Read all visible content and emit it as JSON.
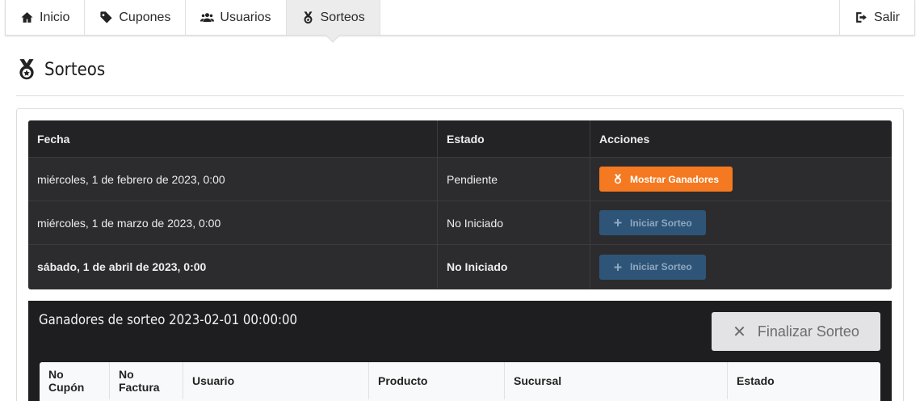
{
  "nav": {
    "items": [
      {
        "label": "Inicio",
        "icon": "home-icon"
      },
      {
        "label": "Cupones",
        "icon": "tag-icon"
      },
      {
        "label": "Usuarios",
        "icon": "users-icon"
      },
      {
        "label": "Sorteos",
        "icon": "medal-icon",
        "active": true
      }
    ],
    "logout": {
      "label": "Salir",
      "icon": "sign-out-icon"
    }
  },
  "page": {
    "title": "Sorteos",
    "icon": "medal-icon"
  },
  "draws_table": {
    "headers": [
      "Fecha",
      "Estado",
      "Acciones"
    ],
    "rows": [
      {
        "fecha": "miércoles, 1 de febrero de 2023, 0:00",
        "estado": "Pendiente",
        "action": "Mostrar Ganadores"
      },
      {
        "fecha": "miércoles, 1 de marzo de 2023, 0:00",
        "estado": "No Iniciado",
        "action": "Iniciar Sorteo"
      },
      {
        "fecha": "sábado, 1 de abril de 2023, 0:00",
        "estado": "No Iniciado",
        "action": "Iniciar Sorteo"
      }
    ]
  },
  "winners": {
    "title": "Ganadores de sorteo 2023-02-01 00:00:00",
    "finalize_label": "Finalizar Sorteo",
    "headers": [
      "No Cupón",
      "No Factura",
      "Usuario",
      "Producto",
      "Sucursal",
      "Estado"
    ]
  },
  "colors": {
    "accent_orange": "#f47920",
    "action_blue": "#2e5578",
    "table_dark": "#2c2c2e"
  }
}
